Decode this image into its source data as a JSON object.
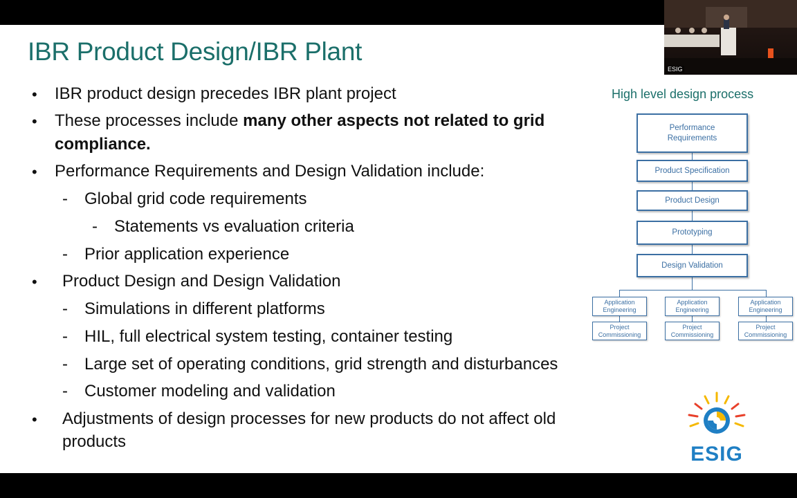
{
  "slide": {
    "title": "IBR Product Design/IBR Plant",
    "bullets": {
      "b1": "IBR product design precedes IBR plant project",
      "b2_pre": "These processes include ",
      "b2_bold1": "many other aspects not related to grid",
      "b2_bold2": "compliance.",
      "b3": "Performance Requirements and Design Validation  include:",
      "b3_s1": "Global grid code requirements",
      "b3_s1_s1": "Statements vs evaluation criteria",
      "b3_s2": "Prior application experience",
      "b4": "Product Design and Design Validation",
      "b4_s1": "Simulations in different platforms",
      "b4_s2": "HIL, full electrical system testing, container testing",
      "b4_s3": "Large set of operating conditions, grid strength and disturbances",
      "b4_s4": "Customer modeling and validation",
      "b5_l1": "Adjustments of design processes for new products do not affect old",
      "b5_l2": "products"
    },
    "bullet_char": "•",
    "dash_char": "-"
  },
  "diagram": {
    "caption": "High level design process",
    "steps": {
      "s1_l1": "Performance",
      "s1_l2": "Requirements",
      "s2": "Product Specification",
      "s3": "Product Design",
      "s4": "Prototyping",
      "s5": "Design Validation"
    },
    "branches": {
      "app_l1": "Application",
      "app_l2": "Engineering",
      "proj_l1": "Project",
      "proj_l2": "Commissioning"
    },
    "color": "#3b6fa3"
  },
  "video": {
    "label": "ESIG"
  },
  "logo": {
    "text": "ESIG",
    "colors": {
      "blue": "#1f7fc4",
      "gold": "#f5b800",
      "red": "#e8402a"
    }
  }
}
